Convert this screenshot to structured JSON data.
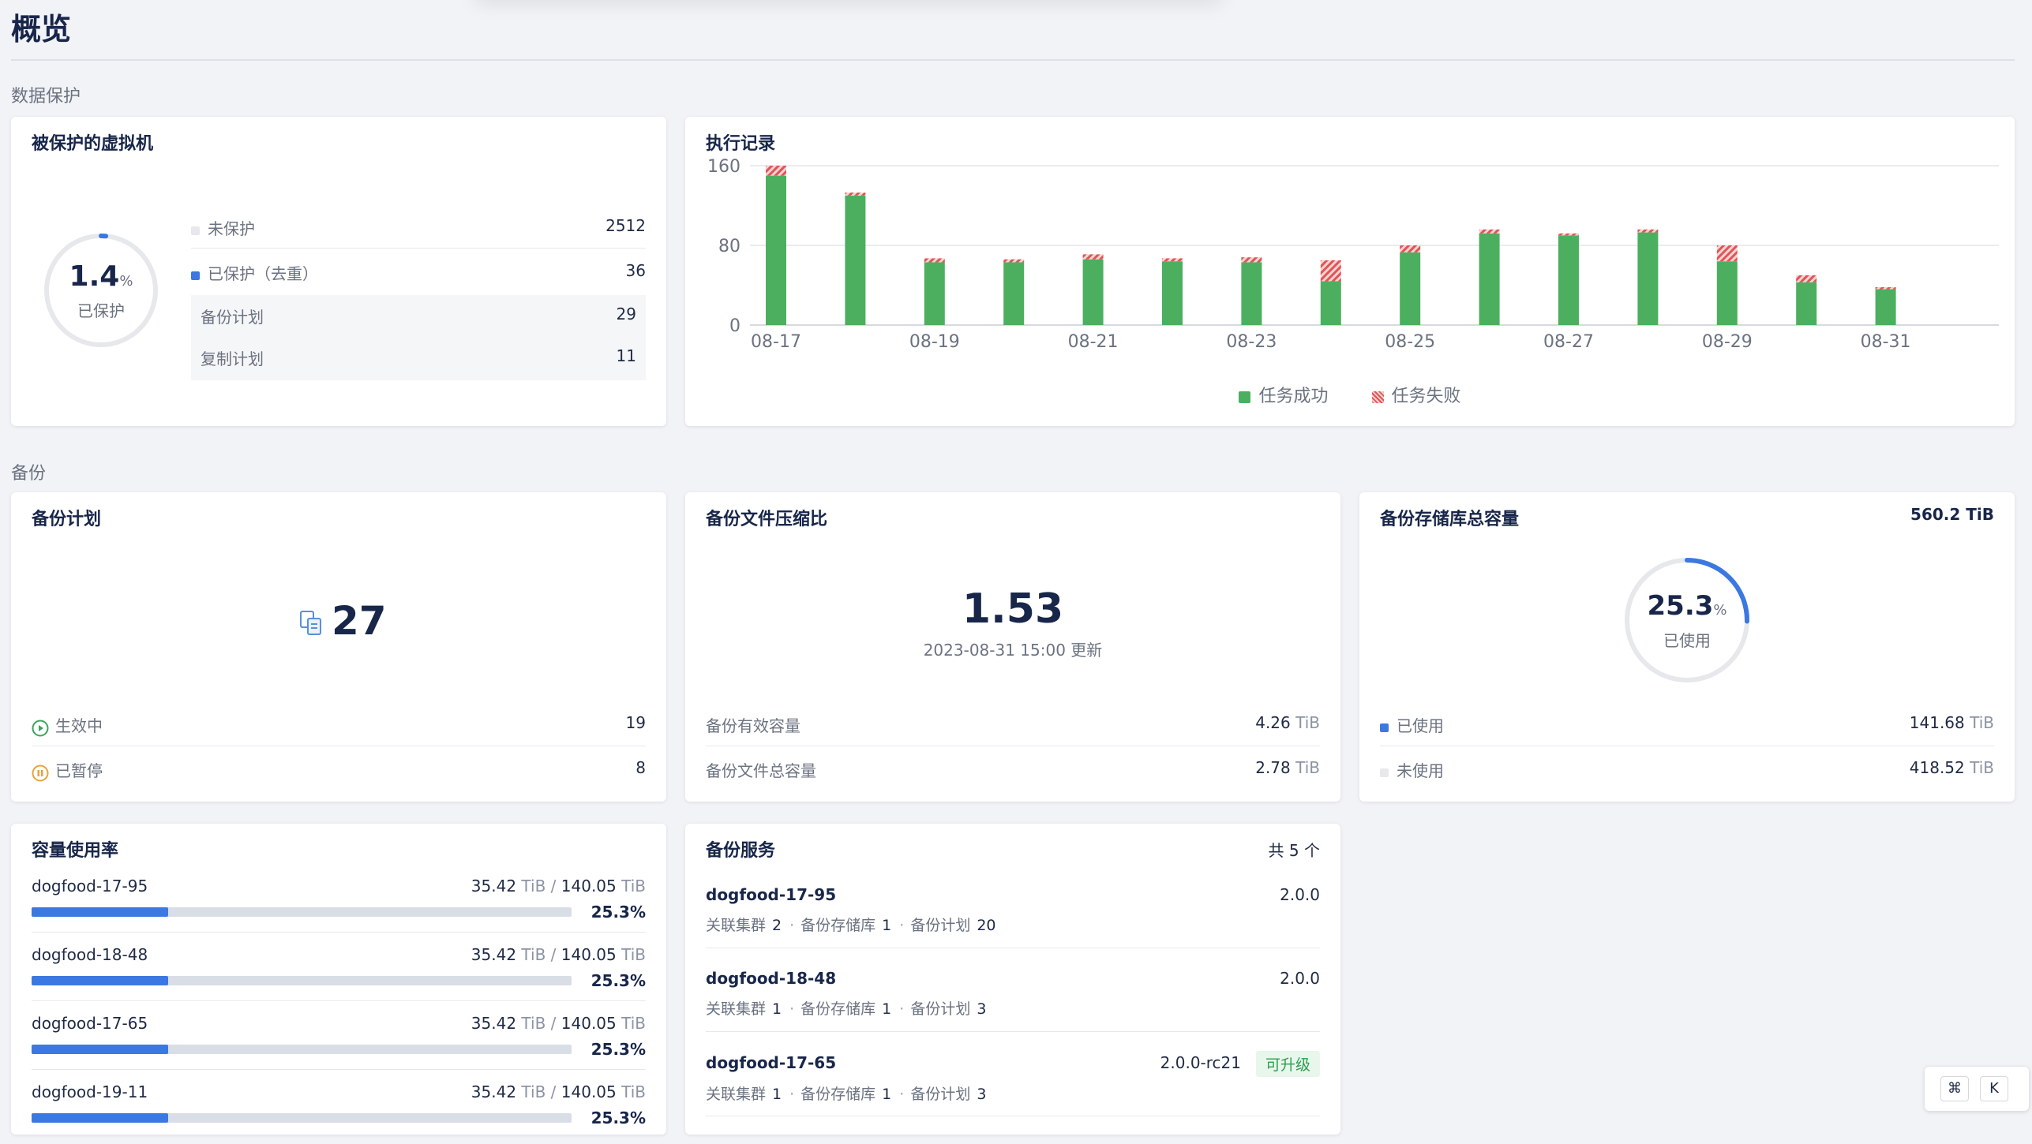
{
  "page": {
    "title": "概览"
  },
  "sections": {
    "protection": "数据保护",
    "backup": "备份"
  },
  "protected_vms": {
    "title": "被保护的虚拟机",
    "percent": "1.4",
    "percent_unit": "%",
    "percent_label": "已保护",
    "percent_value": 1.4,
    "rows": [
      {
        "label": "未保护",
        "value": "2512",
        "color": "#e6e8ec"
      },
      {
        "label": "已保护（去重）",
        "value": "36",
        "color": "#3c78e2"
      }
    ],
    "sub_rows": [
      {
        "label": "备份计划",
        "value": "29"
      },
      {
        "label": "复制计划",
        "value": "11"
      }
    ]
  },
  "exec_records": {
    "title": "执行记录",
    "legend_success": "任务成功",
    "legend_fail": "任务失败",
    "success_color": "#4caf5f",
    "fail_color": "#e05555"
  },
  "chart_data": {
    "type": "bar",
    "stacked": true,
    "categories": [
      "08-17",
      "08-18",
      "08-19",
      "08-20",
      "08-21",
      "08-22",
      "08-23",
      "08-24",
      "08-25",
      "08-26",
      "08-27",
      "08-28",
      "08-29",
      "08-30",
      "08-31"
    ],
    "x_tick_labels": [
      "08-17",
      "08-19",
      "08-21",
      "08-23",
      "08-25",
      "08-27",
      "08-29",
      "08-31"
    ],
    "series": [
      {
        "name": "任务成功",
        "values": [
          150,
          130,
          63,
          63,
          66,
          64,
          63,
          44,
          73,
          92,
          90,
          93,
          64,
          43,
          36
        ]
      },
      {
        "name": "任务失败",
        "values": [
          10,
          3,
          4,
          3,
          5,
          3,
          5,
          21,
          7,
          4,
          2,
          3,
          16,
          7,
          2
        ]
      }
    ],
    "y_ticks": [
      "160",
      "80",
      "0"
    ],
    "ylim": [
      0,
      160
    ],
    "grid": true,
    "legend": "bottom-center"
  },
  "backup_plan": {
    "title": "备份计划",
    "count": "27",
    "rows": [
      {
        "label": "生效中",
        "value": "19"
      },
      {
        "label": "已暂停",
        "value": "8"
      }
    ]
  },
  "compression": {
    "title": "备份文件压缩比",
    "ratio": "1.53",
    "updated": "2023-08-31 15:00 更新",
    "rows": [
      {
        "label": "备份有效容量",
        "value": "4.26",
        "unit": "TiB"
      },
      {
        "label": "备份文件总容量",
        "value": "2.78",
        "unit": "TiB"
      }
    ]
  },
  "repo_capacity": {
    "title": "备份存储库总容量",
    "total": "560.2 TiB",
    "percent": "25.3",
    "percent_unit": "%",
    "percent_label": "已使用",
    "percent_value": 25.3,
    "rows": [
      {
        "label": "已使用",
        "value": "141.68",
        "unit": "TiB",
        "color": "#3c78e2"
      },
      {
        "label": "未使用",
        "value": "418.52",
        "unit": "TiB",
        "color": "#e6e8ec"
      }
    ]
  },
  "capacity_usage": {
    "title": "容量使用率",
    "items": [
      {
        "name": "dogfood-17-95",
        "used": "35.42",
        "total": "140.05",
        "unit": "TiB",
        "sep": "/",
        "pct": "25.3%",
        "fraction": 0.253
      },
      {
        "name": "dogfood-18-48",
        "used": "35.42",
        "total": "140.05",
        "unit": "TiB",
        "sep": "/",
        "pct": "25.3%",
        "fraction": 0.253
      },
      {
        "name": "dogfood-17-65",
        "used": "35.42",
        "total": "140.05",
        "unit": "TiB",
        "sep": "/",
        "pct": "25.3%",
        "fraction": 0.253
      },
      {
        "name": "dogfood-19-11",
        "used": "35.42",
        "total": "140.05",
        "unit": "TiB",
        "sep": "/",
        "pct": "25.3%",
        "fraction": 0.253
      }
    ]
  },
  "backup_services": {
    "title": "备份服务",
    "count_label": "共 5 个",
    "meta_labels": {
      "cluster": "关联集群",
      "repo": "备份存储库",
      "plan": "备份计划"
    },
    "items": [
      {
        "name": "dogfood-17-95",
        "version": "2.0.0",
        "cluster": "2",
        "repo": "1",
        "plan": "20",
        "tag": ""
      },
      {
        "name": "dogfood-18-48",
        "version": "2.0.0",
        "cluster": "1",
        "repo": "1",
        "plan": "3",
        "tag": ""
      },
      {
        "name": "dogfood-17-65",
        "version": "2.0.0-rc21",
        "cluster": "1",
        "repo": "1",
        "plan": "3",
        "tag": "可升级"
      }
    ]
  },
  "shortcut": {
    "key1": "⌘",
    "key2": "K"
  }
}
